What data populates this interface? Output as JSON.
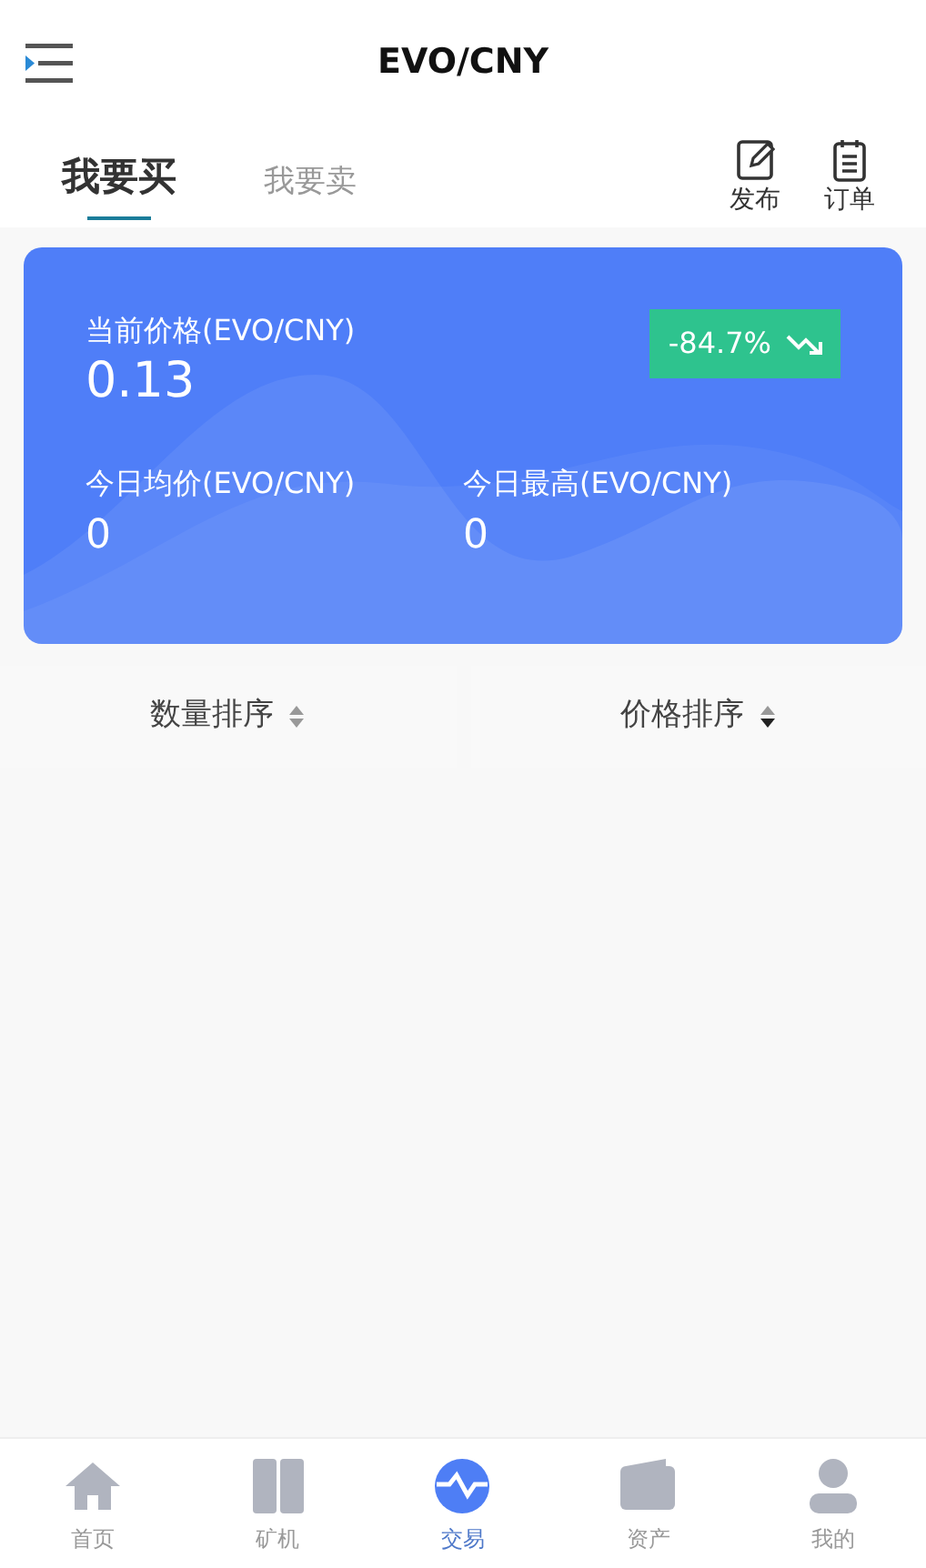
{
  "header": {
    "title": "EVO/CNY"
  },
  "tabs": [
    {
      "label": "我要买",
      "selected": true
    },
    {
      "label": "我要卖",
      "selected": false
    }
  ],
  "actions": [
    {
      "kind": "edit",
      "label": "发布"
    },
    {
      "kind": "list",
      "label": "订单"
    }
  ],
  "price_card": {
    "label": "当前价格(EVO/CNY)",
    "value": "0.13",
    "change": "-84.7%",
    "falling": true,
    "stats": [
      {
        "label": "今日均价(EVO/CNY)",
        "value": "0"
      },
      {
        "label": "今日最高(EVO/CNY)",
        "value": "0"
      }
    ]
  },
  "sorts": [
    {
      "label": "数量排序",
      "selected": false
    },
    {
      "label": "价格排序",
      "selected": true
    }
  ],
  "bottom_nav": [
    {
      "kind": "home",
      "label": "首页",
      "selected": false
    },
    {
      "kind": "miner",
      "label": "矿机",
      "selected": false
    },
    {
      "kind": "trade",
      "label": "交易",
      "selected": true
    },
    {
      "kind": "wallet",
      "label": "资产",
      "selected": false
    },
    {
      "kind": "user",
      "label": "我的",
      "selected": false
    }
  ]
}
